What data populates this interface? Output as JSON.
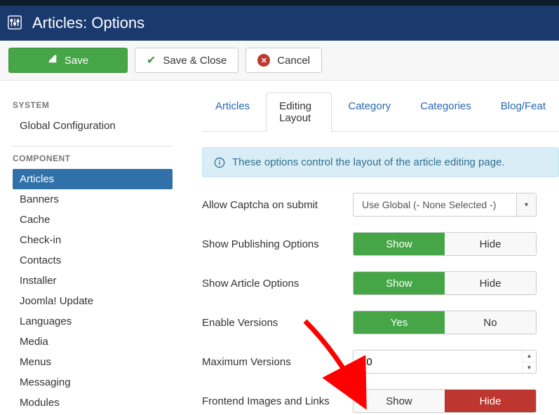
{
  "header": {
    "title": "Articles: Options"
  },
  "toolbar": {
    "save": "Save",
    "save_close": "Save & Close",
    "cancel": "Cancel"
  },
  "sidebar": {
    "system_hdr": "SYSTEM",
    "global_config": "Global Configuration",
    "component_hdr": "COMPONENT",
    "items": [
      "Articles",
      "Banners",
      "Cache",
      "Check-in",
      "Contacts",
      "Installer",
      "Joomla! Update",
      "Languages",
      "Media",
      "Menus",
      "Messaging",
      "Modules"
    ],
    "active_index": 0
  },
  "tabs": {
    "items": [
      "Articles",
      "Editing Layout",
      "Category",
      "Categories",
      "Blog/Feat"
    ],
    "active_index": 1
  },
  "info_msg": "These options control the layout of the article editing page.",
  "fields": {
    "captcha": {
      "label": "Allow Captcha on submit",
      "value": "Use Global (- None Selected -)"
    },
    "publishing": {
      "label": "Show Publishing Options",
      "on": "Show",
      "off": "Hide",
      "value": "Show"
    },
    "article_opts": {
      "label": "Show Article Options",
      "on": "Show",
      "off": "Hide",
      "value": "Show"
    },
    "versions": {
      "label": "Enable Versions",
      "on": "Yes",
      "off": "No",
      "value": "Yes"
    },
    "max_versions": {
      "label": "Maximum Versions",
      "value": "10"
    },
    "images_links": {
      "label": "Frontend Images and Links",
      "on": "Show",
      "off": "Hide",
      "value": "Hide"
    }
  }
}
